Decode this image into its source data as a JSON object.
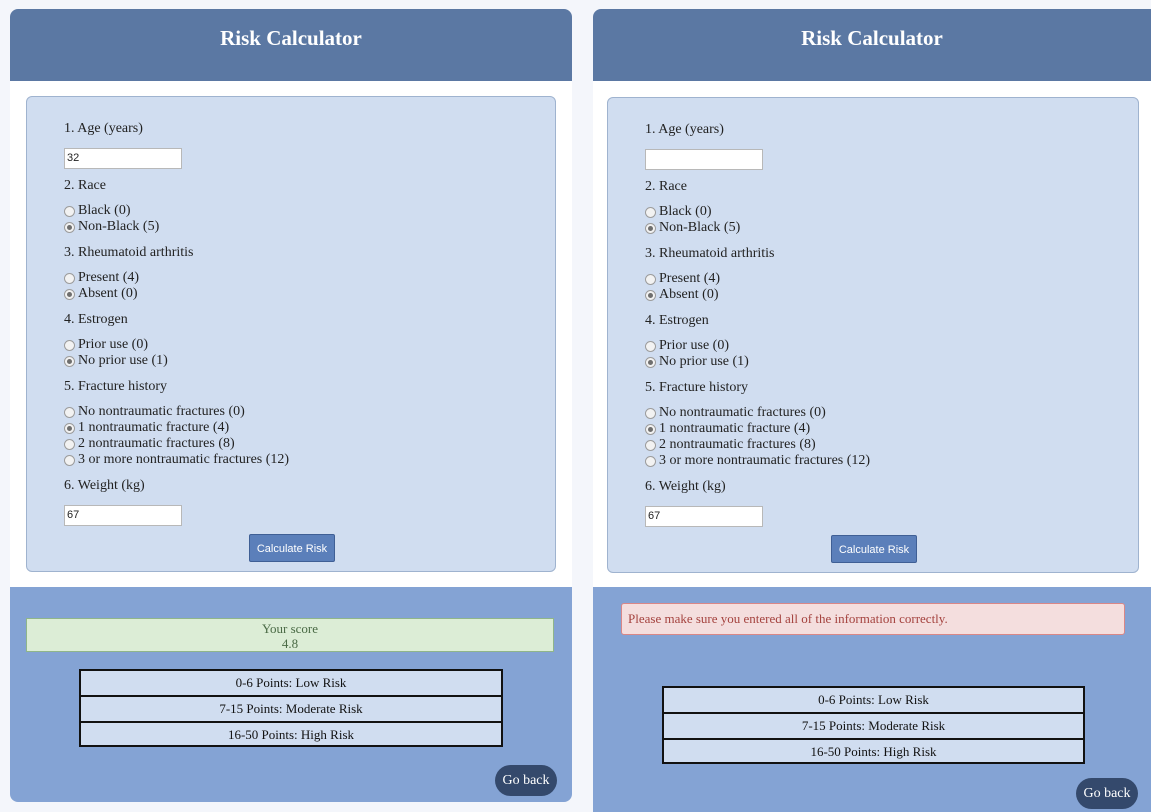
{
  "left": {
    "title": "Risk Calculator",
    "age_label": "1. Age (years)",
    "age_value": "32",
    "race_label": "2. Race",
    "race_opt1": "Black (0)",
    "race_opt2": "Non-Black (5)",
    "ra_label": "3. Rheumatoid arthritis",
    "ra_opt1": "Present (4)",
    "ra_opt2": "Absent (0)",
    "estrogen_label": "4. Estrogen",
    "estrogen_opt1": "Prior use (0)",
    "estrogen_opt2": "No prior use (1)",
    "fracture_label": "5. Fracture history",
    "fracture_opt1": "No nontraumatic fractures (0)",
    "fracture_opt2": "1 nontraumatic fracture (4)",
    "fracture_opt3": "2 nontraumatic fractures (8)",
    "fracture_opt4": "3 or more nontraumatic fractures (12)",
    "weight_label": "6. Weight (kg)",
    "weight_value": "67",
    "calc_button": "Calculate Risk",
    "score_label": "Your score",
    "score_value": "4.8",
    "risk_low": "0-6 Points:  Low Risk",
    "risk_mod": "7-15 Points:  Moderate Risk",
    "risk_high": "16-50 Points:  High Risk",
    "go_back": "Go back"
  },
  "right": {
    "title": "Risk Calculator",
    "age_label": "1. Age (years)",
    "age_value": "",
    "race_label": "2. Race",
    "race_opt1": "Black (0)",
    "race_opt2": "Non-Black (5)",
    "ra_label": "3. Rheumatoid arthritis",
    "ra_opt1": "Present (4)",
    "ra_opt2": "Absent (0)",
    "estrogen_label": "4. Estrogen",
    "estrogen_opt1": "Prior use (0)",
    "estrogen_opt2": "No prior use (1)",
    "fracture_label": "5. Fracture history",
    "fracture_opt1": "No nontraumatic fractures (0)",
    "fracture_opt2": "1 nontraumatic fracture (4)",
    "fracture_opt3": "2 nontraumatic fractures (8)",
    "fracture_opt4": "3 or more nontraumatic fractures (12)",
    "weight_label": "6. Weight (kg)",
    "weight_value": "67",
    "calc_button": "Calculate Risk",
    "error_message": "Please make sure you entered all of the information correctly.",
    "risk_low": "0-6 Points:  Low Risk",
    "risk_mod": "7-15 Points:  Moderate Risk",
    "risk_high": "16-50 Points:  High Risk",
    "go_back": "Go back"
  },
  "colors": {
    "header": "#5b78a3",
    "form_bg": "#d0ddf0",
    "result_bg": "#84a3d4",
    "button": "#5b7fba",
    "go_back": "#34496c",
    "score_bg": "#dcedd6",
    "error_bg": "#f4dede",
    "error_text": "#a4423e"
  }
}
